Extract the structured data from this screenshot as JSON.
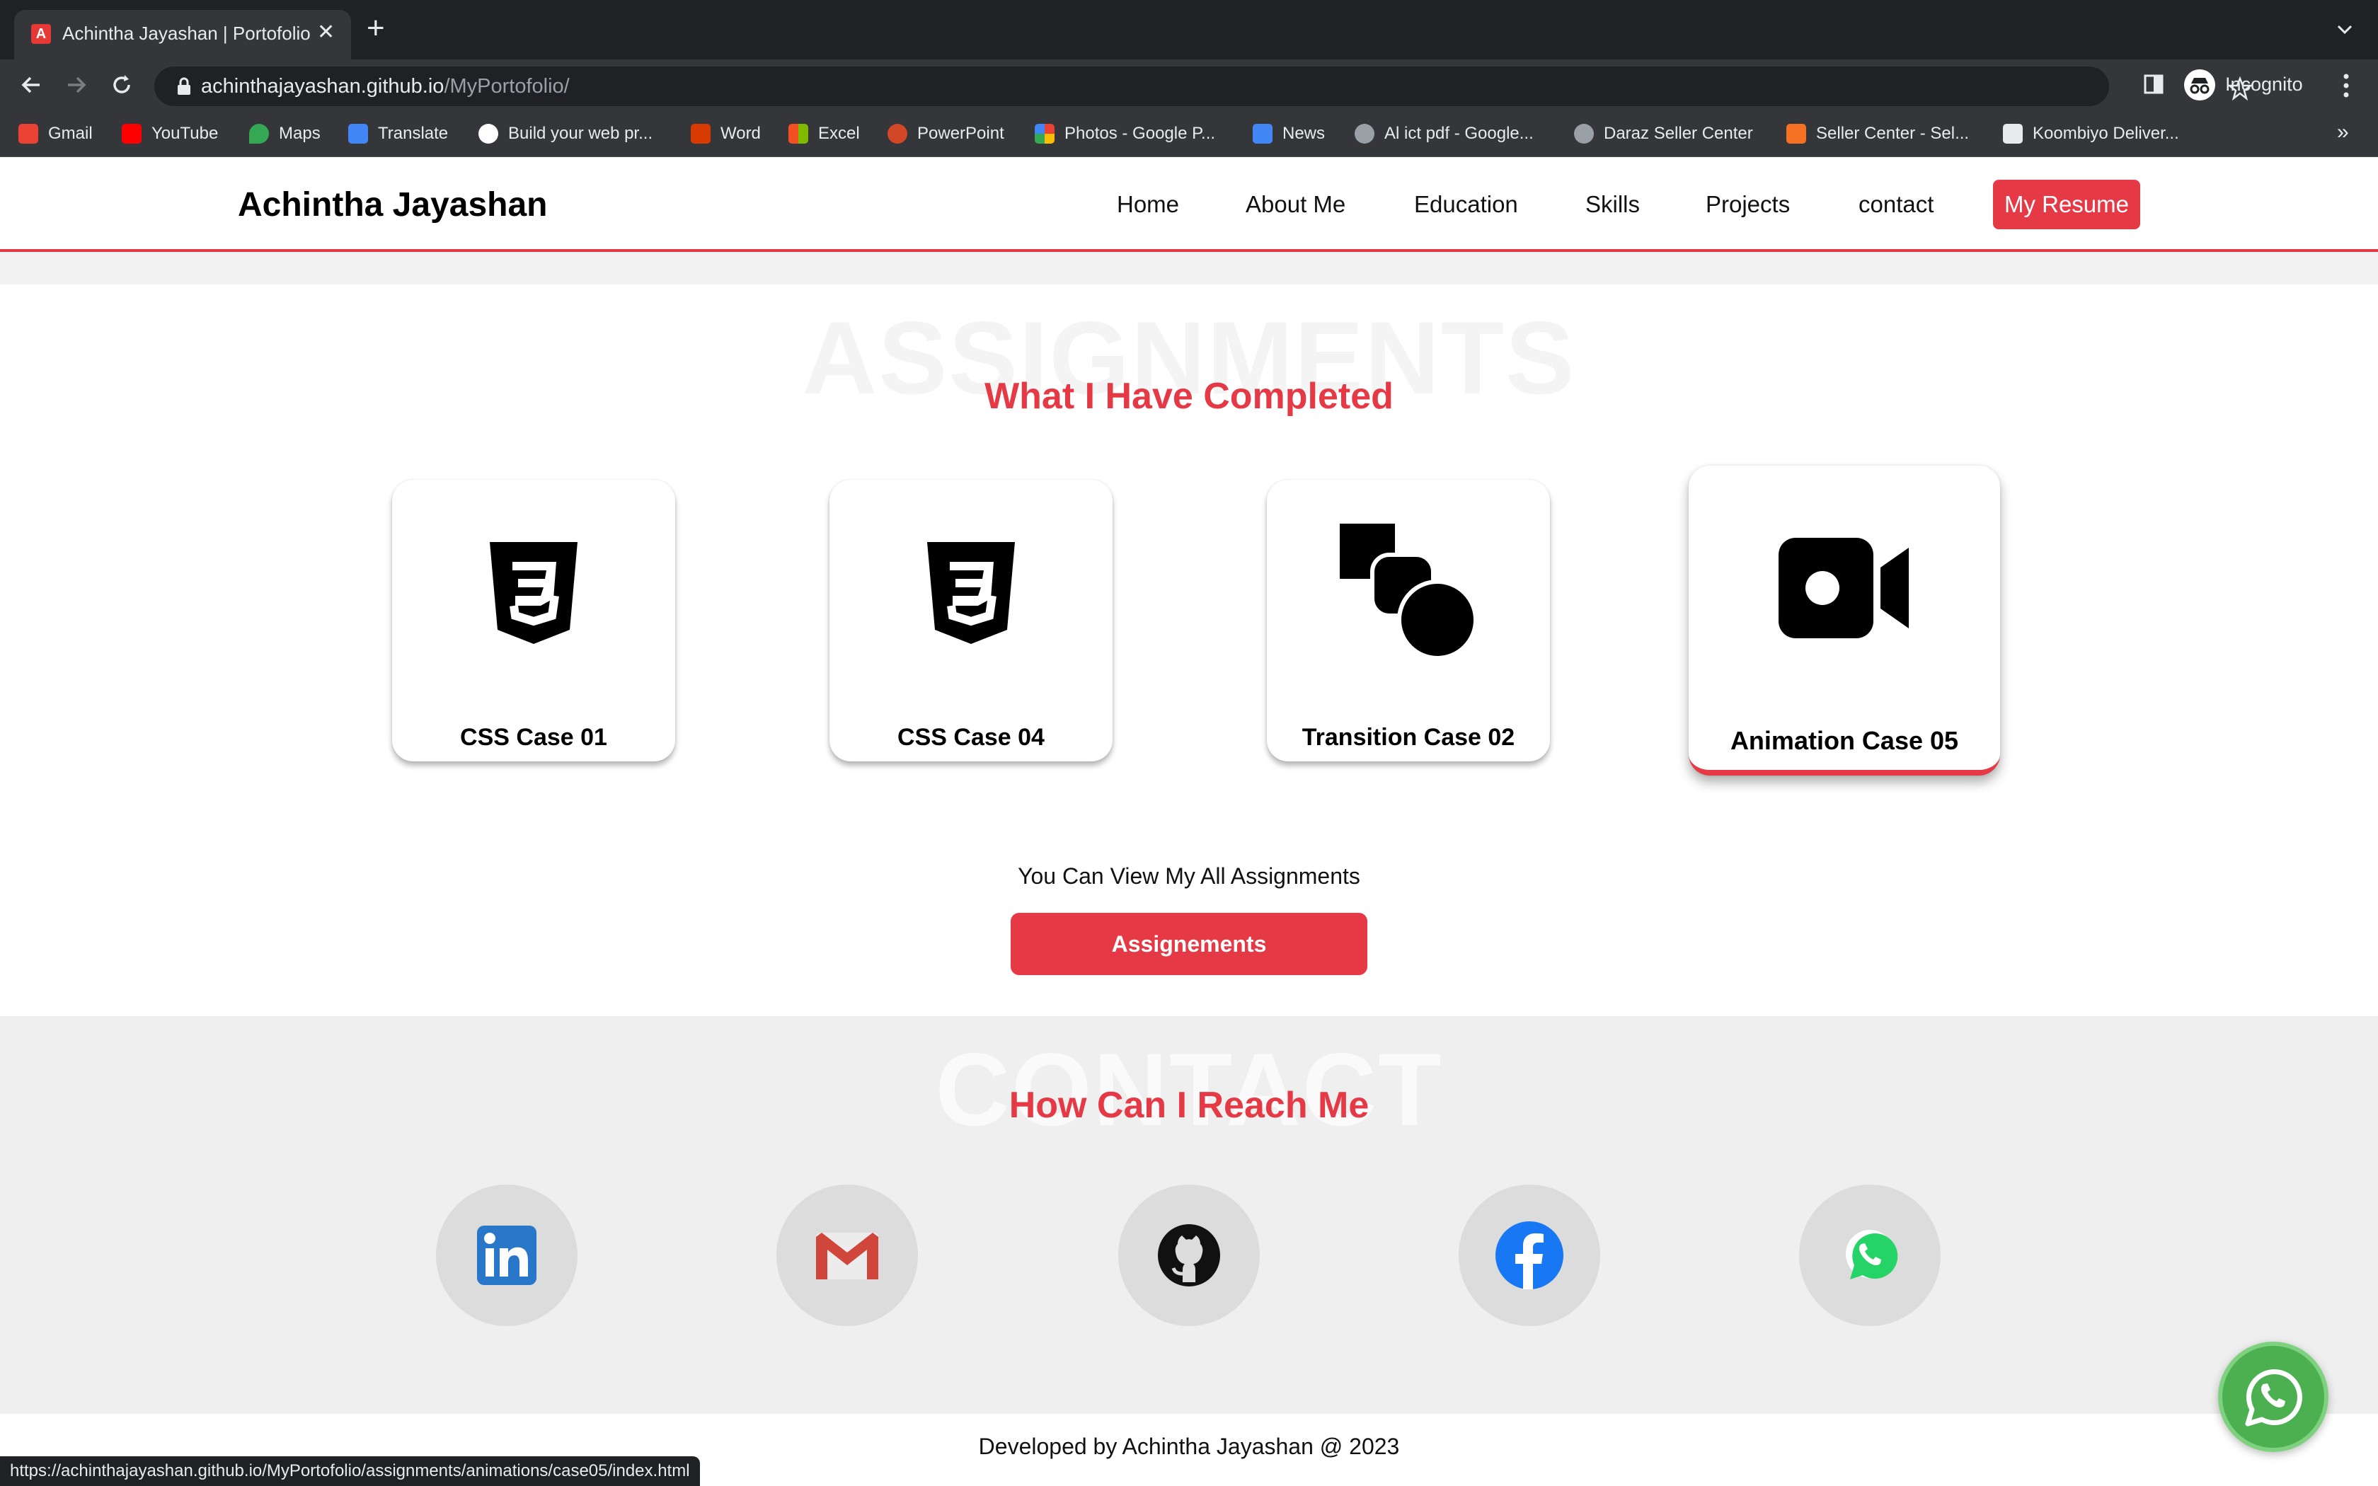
{
  "browser": {
    "tab_title": "Achintha Jayashan | Portofolio",
    "tab_close": "✕",
    "new_tab": "+",
    "url_host": "achinthajayashan.github.io",
    "url_path": "/MyPortofolio/",
    "profile_label": "Incognito",
    "bookmarks_more": "»",
    "bookmarks": [
      {
        "label": "Gmail",
        "color": "#ea4335"
      },
      {
        "label": "YouTube",
        "color": "#ff0000"
      },
      {
        "label": "Maps",
        "color": "#34a853"
      },
      {
        "label": "Translate",
        "color": "#4285f4"
      },
      {
        "label": "Build your web pr...",
        "color": "#ffffff"
      },
      {
        "label": "Word",
        "color": "#d83b01"
      },
      {
        "label": "Excel",
        "color": "#4caf50"
      },
      {
        "label": "PowerPoint",
        "color": "#d24726"
      },
      {
        "label": "Photos - Google P...",
        "color": "#fbbc04"
      },
      {
        "label": "News",
        "color": "#4285f4"
      },
      {
        "label": "Al ict pdf - Google...",
        "color": "#9aa0a6"
      },
      {
        "label": "Daraz Seller Center",
        "color": "#9aa0a6"
      },
      {
        "label": "Seller Center - Sel...",
        "color": "#f57224"
      },
      {
        "label": "Koombiyo Deliver...",
        "color": "#e8eaed"
      }
    ],
    "status_url": "https://achinthajayashan.github.io/MyPortofolio/assignments/animations/case05/index.html"
  },
  "site": {
    "brand": "Achintha Jayashan",
    "nav": [
      "Home",
      "About Me",
      "Education",
      "Skills",
      "Projects",
      "contact"
    ],
    "resume_button": "My Resume",
    "accent_color": "#e63946"
  },
  "assignments": {
    "bg_title": "ASSIGNMENTS",
    "subtitle": "What I Have Completed",
    "cards": [
      {
        "label": "CSS Case 01",
        "icon": "css3-icon"
      },
      {
        "label": "CSS Case 04",
        "icon": "css3-icon"
      },
      {
        "label": "Transition Case 02",
        "icon": "shapes-icon"
      },
      {
        "label": "Animation Case 05",
        "icon": "video-camera-icon",
        "active": true
      }
    ],
    "view_text": "You Can View My All Assignments",
    "button": "Assignements"
  },
  "contact": {
    "bg_title": "CONTACT",
    "subtitle": "How Can I Reach Me",
    "socials": [
      "linkedin-icon",
      "gmail-icon",
      "github-icon",
      "facebook-icon",
      "whatsapp-icon"
    ]
  },
  "footer": {
    "text": "Developed by Achintha Jayashan @ 2023"
  }
}
